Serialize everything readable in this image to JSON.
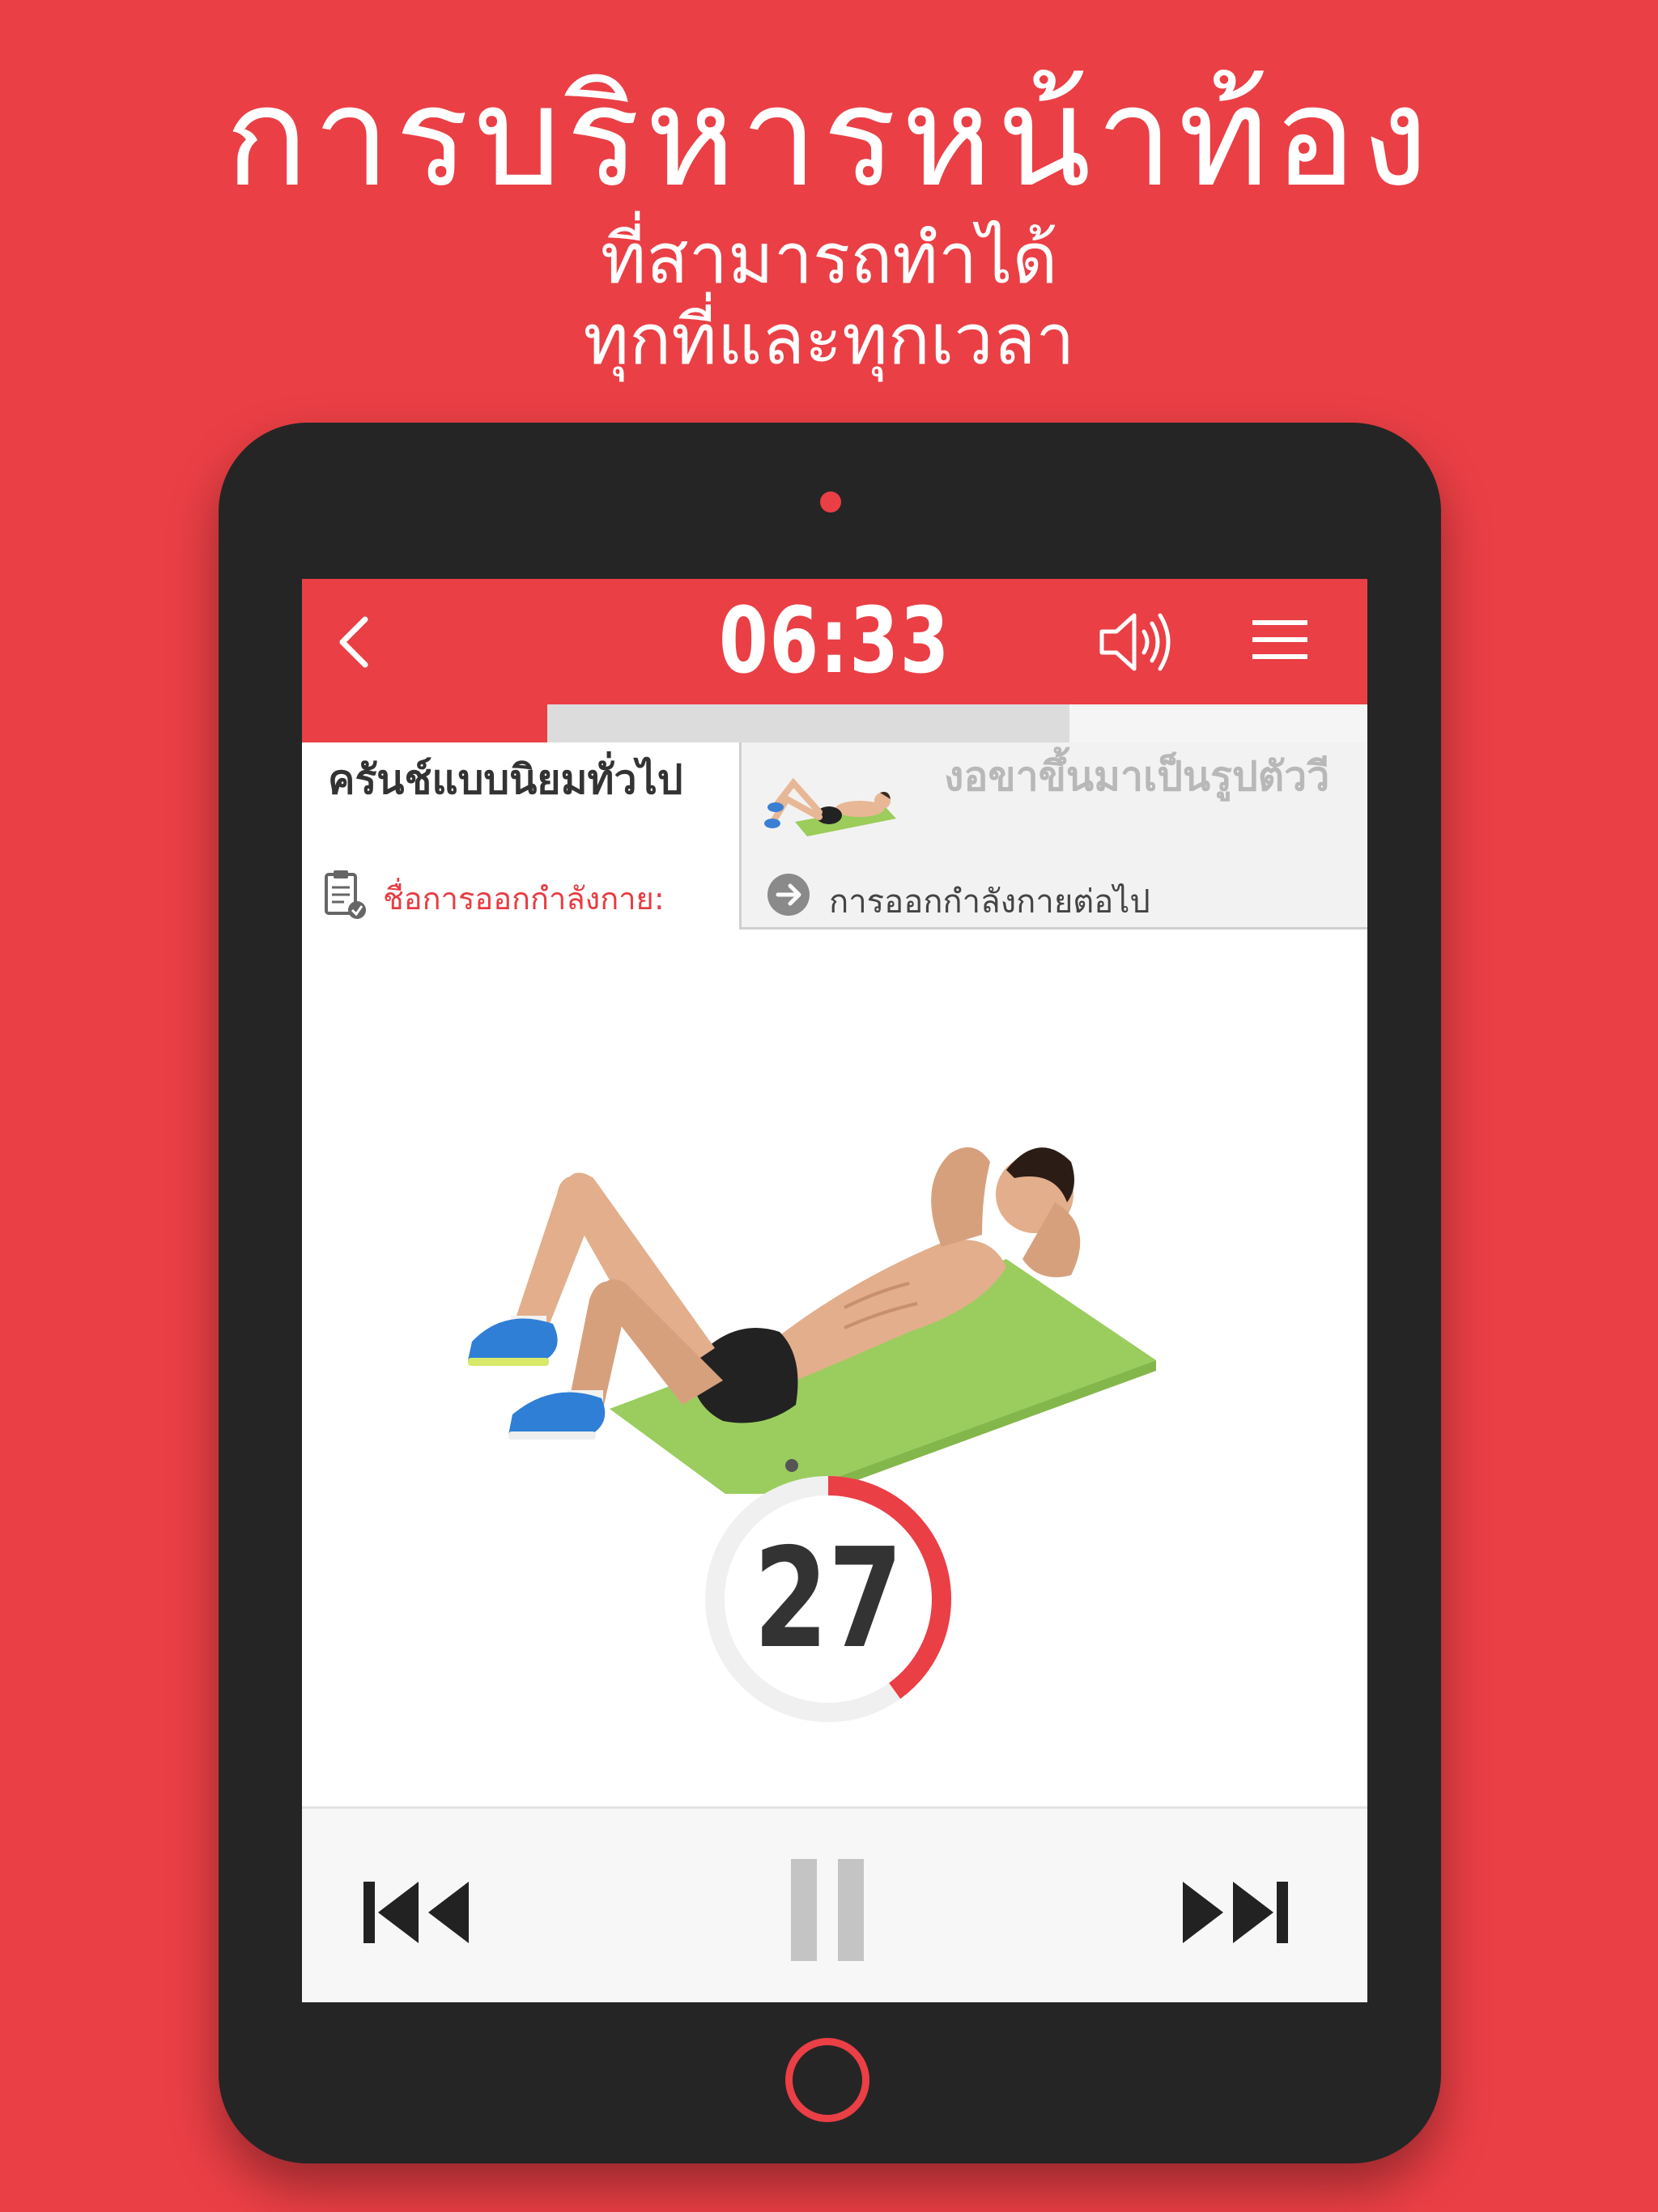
{
  "headline": {
    "line1": "การบริหารหน้าท้อง",
    "line2": "ที่สามารถทำได้",
    "line3": "ทุกที่และทุกเวลา"
  },
  "topbar": {
    "timer": "06:33",
    "icons": [
      "back-icon",
      "speaker-icon",
      "menu-icon"
    ]
  },
  "progress": {
    "completed_fraction": 0.23,
    "current_fraction": 0.49
  },
  "current_exercise": {
    "name": "ครันช์แบบนิยมทั่วไป",
    "label": "ชื่อการออกกำลังกาย:"
  },
  "next_exercise": {
    "name": "งอขาขึ้นมาเป็นรูปตัววี",
    "label": "การออกกำลังกายต่อไป"
  },
  "countdown": {
    "value": "27",
    "remaining_fraction": 0.4
  },
  "controls": {
    "icons": [
      "previous-icon",
      "pause-icon",
      "next-icon"
    ]
  },
  "colors": {
    "accent": "#ea3f45",
    "device": "#252525",
    "text_dark": "#333333",
    "text_muted": "#b8b8b8"
  }
}
